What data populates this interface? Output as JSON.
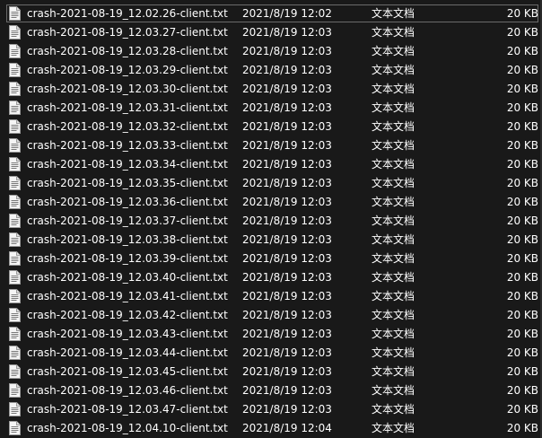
{
  "files": [
    {
      "name": "crash-2021-08-19_12.02.26-client.txt",
      "date": "2021/8/19 12:02",
      "type": "文本文档",
      "size": "20 KB"
    },
    {
      "name": "crash-2021-08-19_12.03.27-client.txt",
      "date": "2021/8/19 12:03",
      "type": "文本文档",
      "size": "20 KB"
    },
    {
      "name": "crash-2021-08-19_12.03.28-client.txt",
      "date": "2021/8/19 12:03",
      "type": "文本文档",
      "size": "20 KB"
    },
    {
      "name": "crash-2021-08-19_12.03.29-client.txt",
      "date": "2021/8/19 12:03",
      "type": "文本文档",
      "size": "20 KB"
    },
    {
      "name": "crash-2021-08-19_12.03.30-client.txt",
      "date": "2021/8/19 12:03",
      "type": "文本文档",
      "size": "20 KB"
    },
    {
      "name": "crash-2021-08-19_12.03.31-client.txt",
      "date": "2021/8/19 12:03",
      "type": "文本文档",
      "size": "20 KB"
    },
    {
      "name": "crash-2021-08-19_12.03.32-client.txt",
      "date": "2021/8/19 12:03",
      "type": "文本文档",
      "size": "20 KB"
    },
    {
      "name": "crash-2021-08-19_12.03.33-client.txt",
      "date": "2021/8/19 12:03",
      "type": "文本文档",
      "size": "20 KB"
    },
    {
      "name": "crash-2021-08-19_12.03.34-client.txt",
      "date": "2021/8/19 12:03",
      "type": "文本文档",
      "size": "20 KB"
    },
    {
      "name": "crash-2021-08-19_12.03.35-client.txt",
      "date": "2021/8/19 12:03",
      "type": "文本文档",
      "size": "20 KB"
    },
    {
      "name": "crash-2021-08-19_12.03.36-client.txt",
      "date": "2021/8/19 12:03",
      "type": "文本文档",
      "size": "20 KB"
    },
    {
      "name": "crash-2021-08-19_12.03.37-client.txt",
      "date": "2021/8/19 12:03",
      "type": "文本文档",
      "size": "20 KB"
    },
    {
      "name": "crash-2021-08-19_12.03.38-client.txt",
      "date": "2021/8/19 12:03",
      "type": "文本文档",
      "size": "20 KB"
    },
    {
      "name": "crash-2021-08-19_12.03.39-client.txt",
      "date": "2021/8/19 12:03",
      "type": "文本文档",
      "size": "20 KB"
    },
    {
      "name": "crash-2021-08-19_12.03.40-client.txt",
      "date": "2021/8/19 12:03",
      "type": "文本文档",
      "size": "20 KB"
    },
    {
      "name": "crash-2021-08-19_12.03.41-client.txt",
      "date": "2021/8/19 12:03",
      "type": "文本文档",
      "size": "20 KB"
    },
    {
      "name": "crash-2021-08-19_12.03.42-client.txt",
      "date": "2021/8/19 12:03",
      "type": "文本文档",
      "size": "20 KB"
    },
    {
      "name": "crash-2021-08-19_12.03.43-client.txt",
      "date": "2021/8/19 12:03",
      "type": "文本文档",
      "size": "20 KB"
    },
    {
      "name": "crash-2021-08-19_12.03.44-client.txt",
      "date": "2021/8/19 12:03",
      "type": "文本文档",
      "size": "20 KB"
    },
    {
      "name": "crash-2021-08-19_12.03.45-client.txt",
      "date": "2021/8/19 12:03",
      "type": "文本文档",
      "size": "20 KB"
    },
    {
      "name": "crash-2021-08-19_12.03.46-client.txt",
      "date": "2021/8/19 12:03",
      "type": "文本文档",
      "size": "20 KB"
    },
    {
      "name": "crash-2021-08-19_12.03.47-client.txt",
      "date": "2021/8/19 12:03",
      "type": "文本文档",
      "size": "20 KB"
    },
    {
      "name": "crash-2021-08-19_12.04.10-client.txt",
      "date": "2021/8/19 12:04",
      "type": "文本文档",
      "size": "20 KB"
    }
  ],
  "selected_index": 0,
  "icon": "text-file-icon",
  "colors": {
    "background": "#191919",
    "text": "#ffffff",
    "selection_border": "#6b6b6b"
  }
}
